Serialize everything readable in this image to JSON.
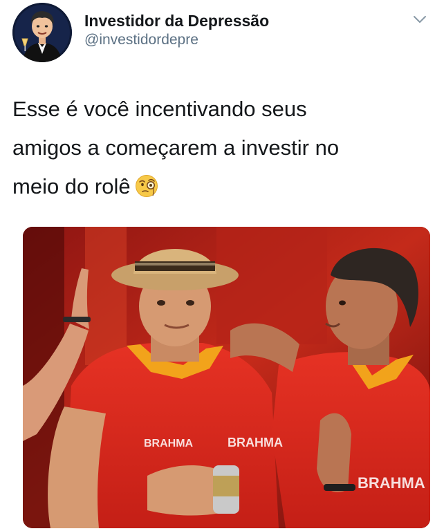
{
  "tweet": {
    "author": {
      "display_name": "Investidor da Depressão",
      "handle": "@investidordepre",
      "avatar_icon": "cartoon-man-in-suit-avatar"
    },
    "menu_icon": "chevron-down-icon",
    "text_lines": [
      "Esse é você incentivando seus",
      "amigos a começarem a investir no",
      "meio do rolê"
    ],
    "emoji": "face-with-monocle",
    "media": {
      "jersey_lettering": "BRAHMA"
    }
  },
  "colors": {
    "text_primary": "#14171a",
    "text_secondary": "#5b7083",
    "jersey_red": "#d9261c",
    "jersey_collar": "#f2a31b",
    "background_red": "#7d1110"
  }
}
